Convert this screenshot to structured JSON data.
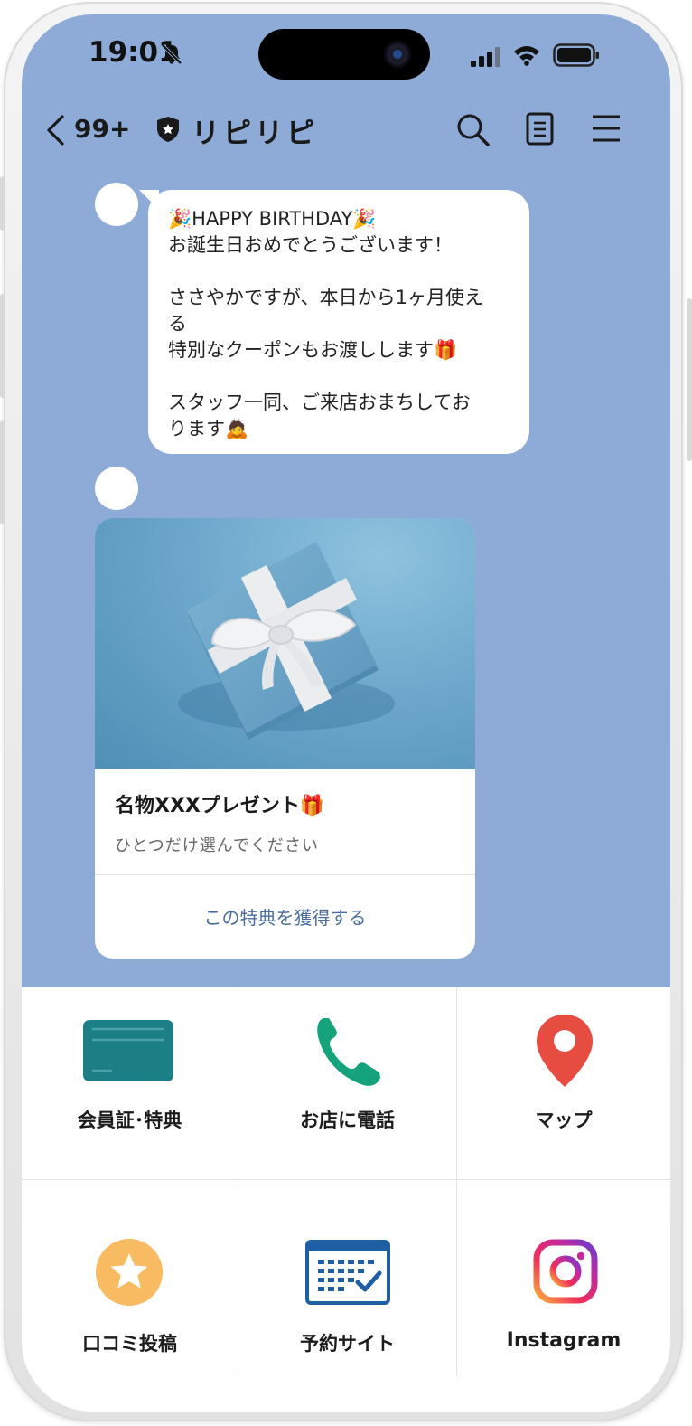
{
  "status_bar": {
    "time": "19:01"
  },
  "header": {
    "back_count": "99+",
    "account_name": "リピリピ"
  },
  "message": {
    "lines": [
      "🎉HAPPY BIRTHDAY🎉",
      "お誕生日おめでとうございます！",
      "",
      "ささやかですが、本日から1ヶ月使え",
      "る",
      "特別なクーポンもお渡しします🎁",
      "",
      "スタッフ一同、ご来店おまちしてお",
      "ります🙇"
    ]
  },
  "card": {
    "title": "名物XXXプレゼント🎁",
    "subtitle": "ひとつだけ選んでください",
    "action_label": "この特典を獲得する"
  },
  "rich_menu": {
    "items": [
      {
        "label": "会員証･特典",
        "icon": "membership-card-icon"
      },
      {
        "label": "お店に電話",
        "icon": "phone-icon"
      },
      {
        "label": "マップ",
        "icon": "map-pin-icon"
      },
      {
        "label": "口コミ投稿",
        "icon": "star-icon"
      },
      {
        "label": "予約サイト",
        "icon": "calendar-icon"
      },
      {
        "label": "Instagram",
        "icon": "instagram-icon"
      }
    ]
  },
  "colors": {
    "chat_background": "#8eabd8",
    "card_action_text": "#4a6d9d",
    "membership_card": "#1c7f86",
    "phone_icon": "#14a37a",
    "map_pin": "#e64c3f",
    "star_circle": "#f8bb62",
    "calendar": "#1e5fa4"
  }
}
